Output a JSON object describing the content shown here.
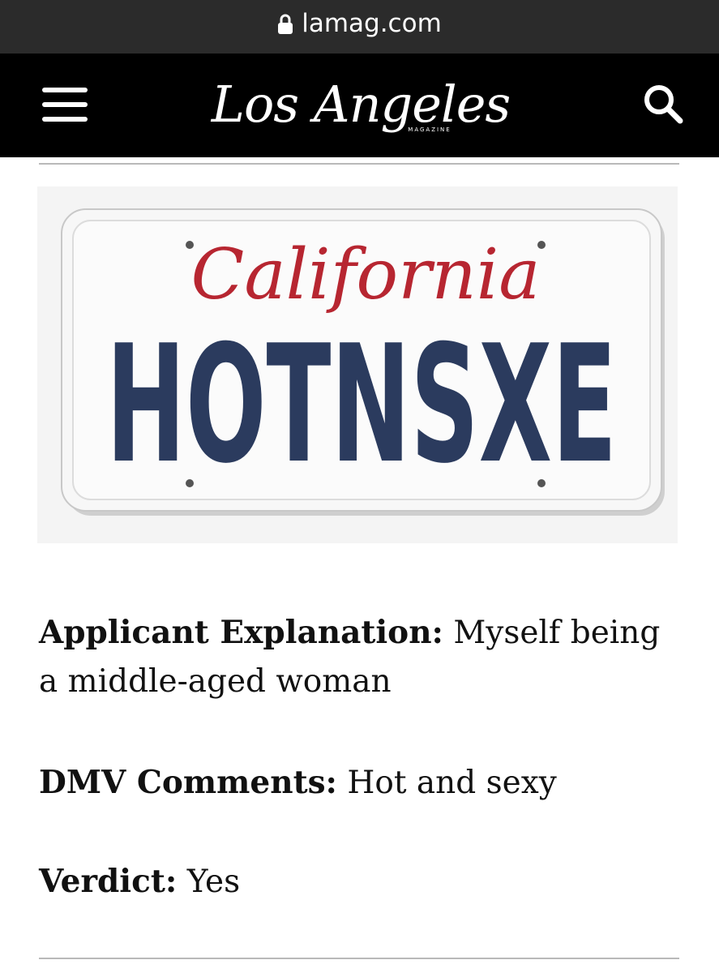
{
  "browser": {
    "url": "lamag.com"
  },
  "header": {
    "logo_text": "Los Angeles",
    "logo_subtext": "MAGAZINE"
  },
  "plate": {
    "state": "California",
    "text": "HOTNSXE",
    "colors": {
      "state": "#b72631",
      "text": "#2b3b5e"
    }
  },
  "article": {
    "applicant_label": "Applicant Explanation:",
    "applicant_value": "Myself being a middle-aged woman",
    "dmv_label": "DMV Comments:",
    "dmv_value": "Hot and sexy",
    "verdict_label": "Verdict:",
    "verdict_value": "Yes"
  }
}
